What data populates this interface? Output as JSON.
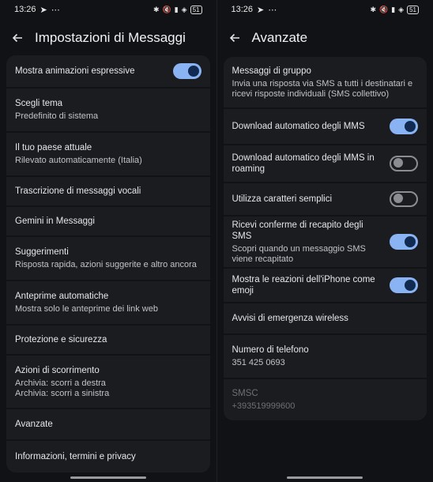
{
  "left": {
    "status": {
      "time": "13:26",
      "battery": "51"
    },
    "title": "Impostazioni di Messaggi",
    "items": [
      {
        "title": "Mostra animazioni espressive",
        "toggle": "on"
      },
      {
        "title": "Scegli tema",
        "subtitle": "Predefinito di sistema"
      },
      {
        "title": "Il tuo paese attuale",
        "subtitle": "Rilevato automaticamente (Italia)"
      },
      {
        "title": "Trascrizione di messaggi vocali"
      },
      {
        "title": "Gemini in Messaggi"
      },
      {
        "title": "Suggerimenti",
        "subtitle": "Risposta rapida, azioni suggerite e altro ancora"
      },
      {
        "title": "Anteprime automatiche",
        "subtitle": "Mostra solo le anteprime dei link web"
      },
      {
        "title": "Protezione e sicurezza"
      },
      {
        "title": "Azioni di scorrimento",
        "subtitle": "Archivia: scorri a destra",
        "subtitle2": "Archivia: scorri a sinistra"
      },
      {
        "title": "Avanzate"
      },
      {
        "title": "Informazioni, termini e privacy"
      }
    ]
  },
  "right": {
    "status": {
      "time": "13:26",
      "battery": "51"
    },
    "title": "Avanzate",
    "items": [
      {
        "title": "Messaggi di gruppo",
        "subtitle": "Invia una risposta via SMS a tutti i destinatari e ricevi risposte individuali (SMS collettivo)"
      },
      {
        "title": "Download automatico degli MMS",
        "toggle": "on"
      },
      {
        "title": "Download automatico degli MMS in roaming",
        "toggle": "off"
      },
      {
        "title": "Utilizza caratteri semplici",
        "toggle": "off"
      },
      {
        "title": "Ricevi conferme di recapito degli SMS",
        "subtitle": "Scopri quando un messaggio SMS viene recapitato",
        "toggle": "on"
      },
      {
        "title": "Mostra le reazioni dell'iPhone come emoji",
        "toggle": "on"
      },
      {
        "title": "Avvisi di emergenza wireless"
      },
      {
        "title": "Numero di telefono",
        "subtitle": "351 425 0693"
      },
      {
        "title": "SMSC",
        "subtitle": "+393519999600",
        "disabled": true
      }
    ]
  }
}
